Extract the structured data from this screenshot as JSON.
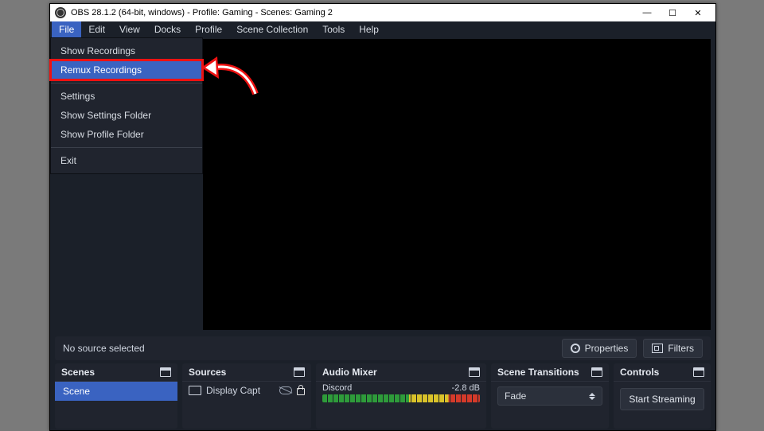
{
  "title": "OBS 28.1.2 (64-bit, windows) - Profile: Gaming - Scenes: Gaming 2",
  "menus": [
    "File",
    "Edit",
    "View",
    "Docks",
    "Profile",
    "Scene Collection",
    "Tools",
    "Help"
  ],
  "file_menu": {
    "show_recordings": "Show Recordings",
    "remux_recordings": "Remux Recordings",
    "settings": "Settings",
    "show_settings_folder": "Show Settings Folder",
    "show_profile_folder": "Show Profile Folder",
    "exit": "Exit"
  },
  "toolbar": {
    "no_source": "No source selected",
    "properties": "Properties",
    "filters": "Filters"
  },
  "panels": {
    "scenes": "Scenes",
    "sources": "Sources",
    "mixer": "Audio Mixer",
    "transitions": "Scene Transitions",
    "controls": "Controls"
  },
  "scenes": {
    "scene1": "Scene"
  },
  "sources": {
    "item1": "Display Capt"
  },
  "mixer": {
    "track": "Discord",
    "level": "-2.8 dB"
  },
  "transitions": {
    "selected": "Fade"
  },
  "controls": {
    "start_stream": "Start Streaming"
  }
}
